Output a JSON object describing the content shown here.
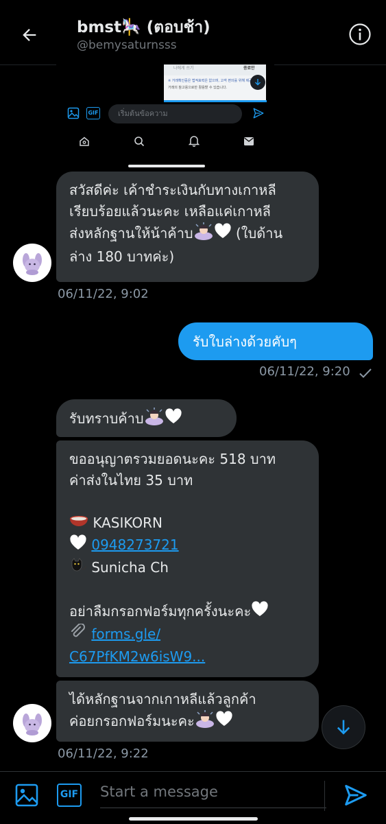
{
  "header": {
    "title": "bmst🎠 (ตอบช้า)",
    "handle": "@bemysaturnsss"
  },
  "preview": {
    "card_left": "나에게 쓰기",
    "card_right": "종료안",
    "card_note1": "※ 거래확인증은 법적효력은 없으며, 고객 편의를 위해 제공된",
    "card_note2": "거래의 참고용으로만 활용할 수 있습니다.",
    "compose_placeholder": "เริ่มต้นข้อความ",
    "gif_label": "GIF"
  },
  "messages": {
    "m1": {
      "lines": [
        "สวัสดีค่ะ เค้าชำระเงินกับทางเกาหลี",
        "เรียบร้อยแล้วนะคะ เหลือแค่เกาหลี",
        "ส่งหลักฐานให้น้าค้าบ",
        "ล่าง 180 บาทค่ะ)"
      ],
      "line3_tail": " (ใบด้าน",
      "time": "06/11/22, 9:02"
    },
    "m2": {
      "text": "รับใบล่างด้วยคับๆ",
      "time": "06/11/22, 9:20"
    },
    "m3": {
      "text": "รับทราบค้าบ"
    },
    "m4": {
      "line1": "ขออนุญาตรวมยอดนะคะ 518 บาท",
      "line2": "ค่าส่งในไทย 35 บาท",
      "bank": "KASIKORN",
      "account": "0948273721",
      "name": "Sunicha Ch",
      "reminder": "อย่าลืมกรอกฟอร์มทุกครั้งนะคะ",
      "link_line1": "forms.gle/",
      "link_line2": "C67PfKM2w6isW9..."
    },
    "m5": {
      "line1": "ได้หลักฐานจากเกาหลีแล้วลูกค้า",
      "line2": "ค่อยกรอกฟอร์มนะคะ",
      "time": "06/11/22, 9:22"
    }
  },
  "composer": {
    "placeholder": "Start a message",
    "gif_label": "GIF"
  },
  "colors": {
    "accent": "#1d9bf0",
    "bubble_in": "#2f3336",
    "background": "#000000"
  }
}
